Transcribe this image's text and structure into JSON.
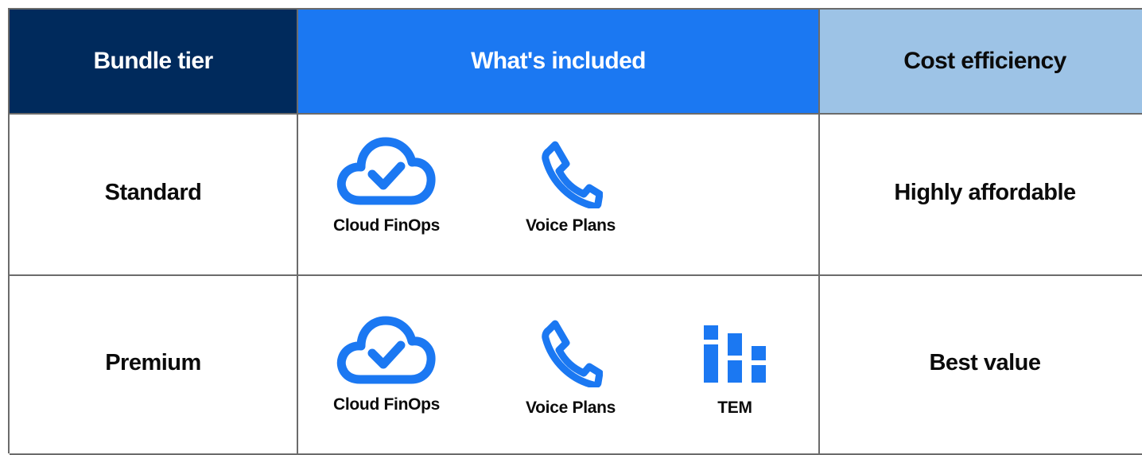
{
  "colors": {
    "header_tier_bg": "#002a5c",
    "header_included_bg": "#1b78f2",
    "header_cost_bg": "#9dc3e6",
    "icon_blue": "#1b78f2",
    "grid_line": "#6b6b6b"
  },
  "headers": {
    "tier": "Bundle tier",
    "included": "What's included",
    "cost": "Cost efficiency"
  },
  "rows": [
    {
      "tier": "Standard",
      "features": [
        {
          "icon": "cloud-check-icon",
          "label": "Cloud FinOps"
        },
        {
          "icon": "phone-icon",
          "label": "Voice Plans"
        }
      ],
      "cost": "Highly affordable"
    },
    {
      "tier": "Premium",
      "features": [
        {
          "icon": "cloud-check-icon",
          "label": "Cloud FinOps"
        },
        {
          "icon": "phone-icon",
          "label": "Voice Plans"
        },
        {
          "icon": "bar-grid-icon",
          "label": "TEM"
        }
      ],
      "cost": "Best value"
    }
  ]
}
